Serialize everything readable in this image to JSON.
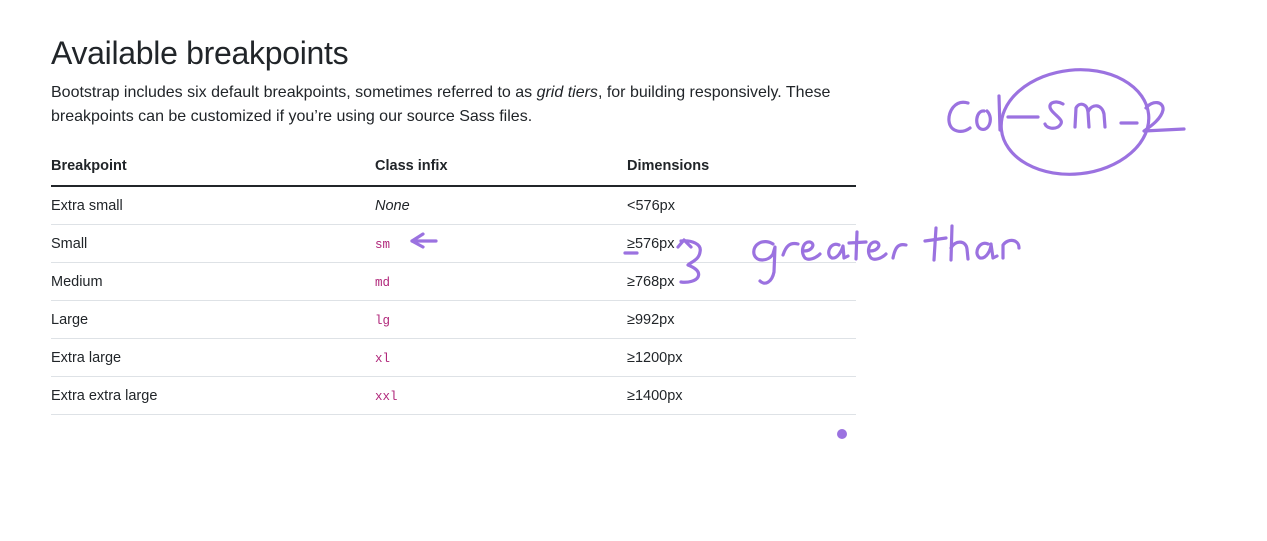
{
  "heading": "Available breakpoints",
  "intro": {
    "before": "Bootstrap includes six default breakpoints, sometimes referred to as ",
    "emphasis": "grid tiers",
    "after": ", for building responsively. These breakpoints can be customized if you’re using our source Sass files."
  },
  "table": {
    "headers": [
      "Breakpoint",
      "Class infix",
      "Dimensions"
    ],
    "rows": [
      {
        "breakpoint": "Extra small",
        "infix": "None",
        "dimensions": "<576px"
      },
      {
        "breakpoint": "Small",
        "infix": "sm",
        "dimensions": "≥576px"
      },
      {
        "breakpoint": "Medium",
        "infix": "md",
        "dimensions": "≥768px"
      },
      {
        "breakpoint": "Large",
        "infix": "lg",
        "dimensions": "≥992px"
      },
      {
        "breakpoint": "Extra large",
        "infix": "xl",
        "dimensions": "≥1200px"
      },
      {
        "breakpoint": "Extra extra large",
        "infix": "xxl",
        "dimensions": "≥1400px"
      }
    ]
  },
  "colors": {
    "text": "#212529",
    "code": "#b0267a",
    "annotation": "#9b72e0",
    "row_border": "#dee2e6"
  }
}
